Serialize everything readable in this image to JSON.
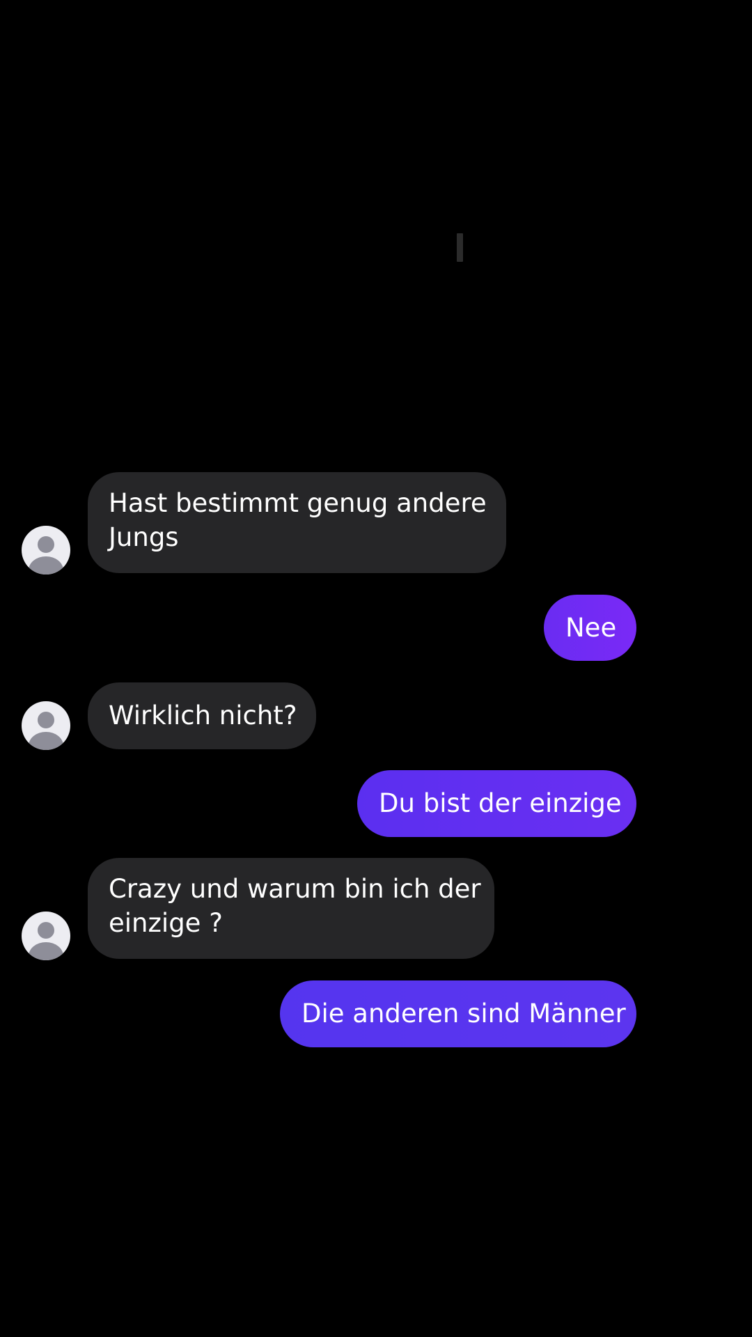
{
  "messages": [
    {
      "direction": "incoming",
      "lines": [
        "Hast bestimmt genug andere",
        "Jungs"
      ]
    },
    {
      "direction": "outgoing",
      "text": "Nee"
    },
    {
      "direction": "incoming",
      "lines": [
        "Wirklich nicht?"
      ]
    },
    {
      "direction": "outgoing",
      "text": "Du bist der einzige"
    },
    {
      "direction": "incoming",
      "lines": [
        "Crazy und warum bin ich der",
        "einzige ?"
      ]
    },
    {
      "direction": "outgoing",
      "text": "Die anderen sind Männer"
    }
  ],
  "colors": {
    "background": "#000000",
    "incoming_bubble": "#262628",
    "outgoing_bubble": "#6a2cf2",
    "avatar_bg": "#ededf2",
    "avatar_fg": "#8e8e99",
    "text": "#ffffff"
  },
  "icons": {
    "avatar": "default-user-avatar-icon"
  }
}
